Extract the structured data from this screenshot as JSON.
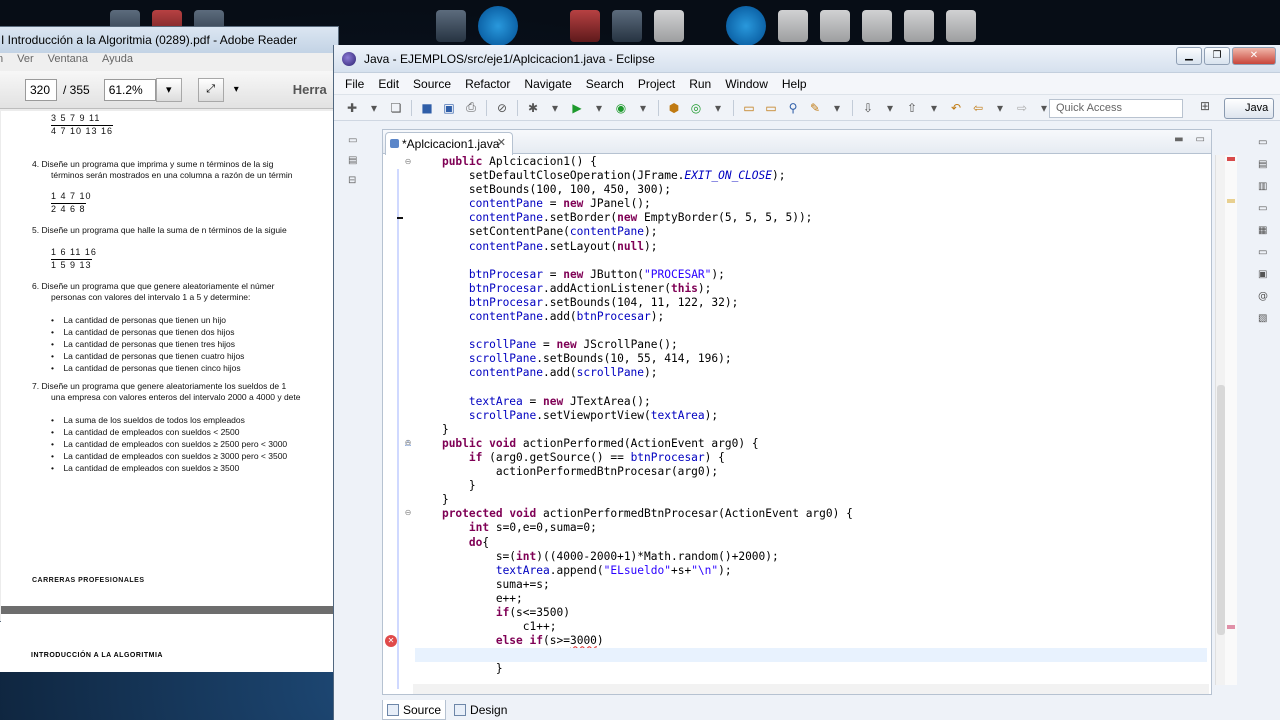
{
  "reader": {
    "title": "I Introducción a la Algoritmia (0289).pdf - Adobe Reader",
    "menu": [
      "n",
      "Ver",
      "Ventana",
      "Ayuda"
    ],
    "page_current": "320",
    "page_total": "/ 355",
    "zoom": "61.2%",
    "tools_label": "Herra",
    "page_lines": [
      "4.   Diseñe un programa que imprima y sume n términos de la sig",
      "términos serán mostrados en una columna a razón de un términ",
      "5.   Diseñe un programa que halle la suma de n términos de la siguie",
      "6.   Diseñe un programa que que genere aleatoriamente el númer",
      "personas con valores del intervalo 1 a 5 y determine:",
      "La cantidad de personas que tienen un hijo",
      "La cantidad de personas que tienen dos hijos",
      "La cantidad de personas que tienen tres hijos",
      "La cantidad de personas que tienen cuatro hijos",
      "La cantidad de personas que tienen cinco hijos",
      "7.   Diseñe un programa que genere aleatoriamente los sueldos de 1",
      "una empresa con valores enteros del intervalo 2000 a 4000 y dete",
      "La suma de los sueldos de todos los empleados",
      "La cantidad de empleados con sueldos < 2500",
      "La cantidad de empleados con sueldos ≥ 2500 pero < 3000",
      "La cantidad de empleados con sueldos ≥  3000 pero < 3500",
      "La cantidad de empleados con sueldos ≥ 3500"
    ],
    "fractions": [
      {
        "num": "3   5   7   9   11",
        "den": "4  7  10  13  16"
      },
      {
        "num": "1   4   7   10",
        "den": "2  4  6  8"
      },
      {
        "num": "1   6   11   16",
        "den": "1  5  9  13"
      }
    ],
    "footer1": "CARRERAS PROFESIONALES",
    "footer2": "INTRODUCCIÓN A LA ALGORITMIA"
  },
  "eclipse": {
    "title": "Java - EJEMPLOS/src/eje1/Aplcicacion1.java - Eclipse",
    "menu": [
      "File",
      "Edit",
      "Source",
      "Refactor",
      "Navigate",
      "Search",
      "Project",
      "Run",
      "Window",
      "Help"
    ],
    "quick_access": "Quick Access",
    "perspective": "Java",
    "tab_label": "*Aplcicacion1.java",
    "bottom_tabs": [
      "Source",
      "Design"
    ]
  },
  "code_lines": [
    "    public Aplcicacion1() {",
    "        setDefaultCloseOperation(JFrame.EXIT_ON_CLOSE);",
    "        setBounds(100, 100, 450, 300);",
    "        contentPane = new JPanel();",
    "        contentPane.setBorder(new EmptyBorder(5, 5, 5, 5));",
    "        setContentPane(contentPane);",
    "        contentPane.setLayout(null);",
    "",
    "        btnProcesar = new JButton(\"PROCESAR\");",
    "        btnProcesar.addActionListener(this);",
    "        btnProcesar.setBounds(104, 11, 122, 32);",
    "        contentPane.add(btnProcesar);",
    "",
    "        scrollPane = new JScrollPane();",
    "        scrollPane.setBounds(10, 55, 414, 196);",
    "        contentPane.add(scrollPane);",
    "",
    "        textArea = new JTextArea();",
    "        scrollPane.setViewportView(textArea);",
    "    }",
    "    public void actionPerformed(ActionEvent arg0) {",
    "        if (arg0.getSource() == btnProcesar) {",
    "            actionPerformedBtnProcesar(arg0);",
    "        }",
    "    }",
    "    protected void actionPerformedBtnProcesar(ActionEvent arg0) {",
    "        int s=0,e=0,suma=0;",
    "        do{",
    "            s=(int)((4000-2000+1)*Math.random()+2000);",
    "            textArea.append(\"ELsueldo\"+s+\"\\n\");",
    "            suma+=s;",
    "            e++;",
    "            if(s<=3500)",
    "                c1++;",
    "            else if(s>=3000)",
    "",
    "            }"
  ]
}
